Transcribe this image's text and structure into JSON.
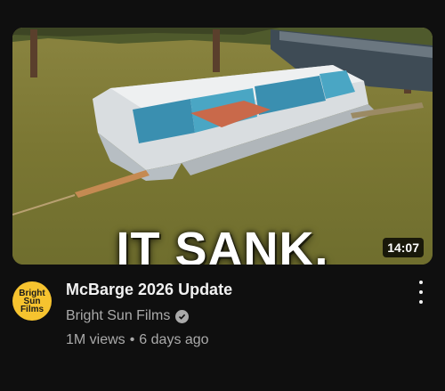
{
  "video": {
    "thumbnail_text": "IT SANK.",
    "duration": "14:07",
    "title": "McBarge 2026 Update",
    "channel": "Bright Sun Films",
    "views": "1M views",
    "age": "6 days ago",
    "separator": "•",
    "avatar_lines": [
      "Bright",
      "Sun",
      "Films"
    ]
  },
  "icons": {
    "verified": "verified-check-icon",
    "menu": "more-vertical-icon"
  },
  "colors": {
    "background": "#0f0f0f",
    "avatar": "#f6c32f",
    "water": "#7d7a34",
    "secondary_text": "#aaaaaa"
  }
}
